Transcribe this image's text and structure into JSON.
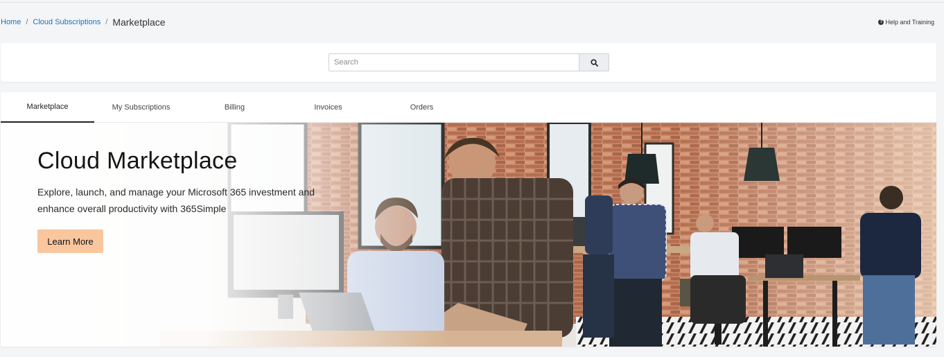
{
  "breadcrumb": {
    "home": "Home",
    "cloud_subscriptions": "Cloud Subscriptions",
    "separator": "/",
    "current": "Marketplace"
  },
  "help": {
    "label": "Help and Training",
    "icon": "question-circle-icon"
  },
  "search": {
    "placeholder": "Search",
    "value": "",
    "icon": "search-icon"
  },
  "tabs": [
    {
      "label": "Marketplace",
      "active": true
    },
    {
      "label": "My Subscriptions",
      "active": false
    },
    {
      "label": "Billing",
      "active": false
    },
    {
      "label": "Invoices",
      "active": false
    },
    {
      "label": "Orders",
      "active": false
    }
  ],
  "hero": {
    "title": "Cloud Marketplace",
    "subtitle": "Explore, launch, and manage your Microsoft 365 investment and enhance overall productivity with 365Simple",
    "button_label": "Learn More",
    "button_color": "#f9c69e"
  },
  "colors": {
    "link": "#1e6fb8",
    "background": "#f4f5f7",
    "card": "#ffffff"
  }
}
